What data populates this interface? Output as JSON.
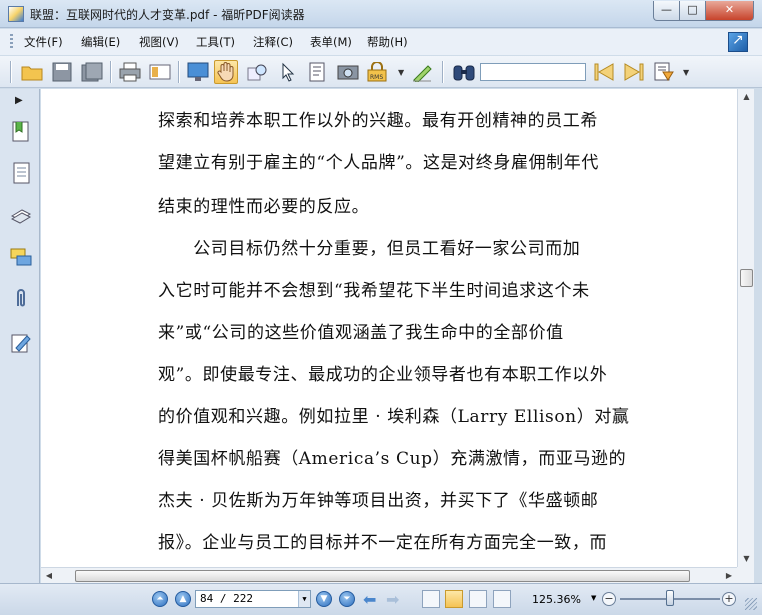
{
  "window": {
    "title": "联盟：互联网时代的人才变革.pdf - 福昕PDF阅读器",
    "min_label": "—",
    "max_label": "□",
    "close_label": "✕"
  },
  "menu": {
    "items": [
      "文件(F)",
      "编辑(E)",
      "视图(V)",
      "工具(T)",
      "注释(C)",
      "表单(M)",
      "帮助(H)"
    ]
  },
  "toolbar": {
    "search_value": "",
    "icons": [
      "open-folder-icon",
      "save-icon",
      "save-as-icon",
      "print-icon",
      "email-icon",
      "fullscreen-icon",
      "hand-tool-icon",
      "zoom-tool-icon",
      "select-tool-icon",
      "text-select-icon",
      "snapshot-icon",
      "rms-icon",
      "sign-icon",
      "find-icon",
      "find-prev-icon",
      "find-next-icon",
      "highlight-icon"
    ]
  },
  "sidebar": {
    "icons": [
      "bookmarks-icon",
      "pages-icon",
      "layers-icon",
      "comments-icon",
      "attachments-icon",
      "signatures-icon"
    ]
  },
  "document": {
    "lines": [
      "探索和培养本职工作以外的兴趣。最有开创精神的员工希",
      "望建立有别于雇主的“个人品牌”。这是对终身雇佣制年代",
      "结束的理性而必要的反应。",
      "　　公司目标仍然十分重要，但员工看好一家公司而加",
      "入它时可能并不会想到“我希望花下半生时间追求这个未",
      "来”或“公司的这些价值观涵盖了我生命中的全部价值",
      "观”。即使最专注、最成功的企业领导者也有本职工作以外",
      "的价值观和兴趣。例如拉里 · 埃利森（Larry Ellison）对赢",
      "得美国杯帆船赛（America’s Cup）充满激情，而亚马逊的",
      "杰夫 · 贝佐斯为万年钟等项目出资，并买下了《华盛顿邮",
      "报》。企业与员工的目标并不一定在所有方面完全一致，而"
    ]
  },
  "statusbar": {
    "page_value": "84 / 222",
    "zoom_value": "125.36%",
    "zoom_out": "−",
    "zoom_in": "+"
  }
}
